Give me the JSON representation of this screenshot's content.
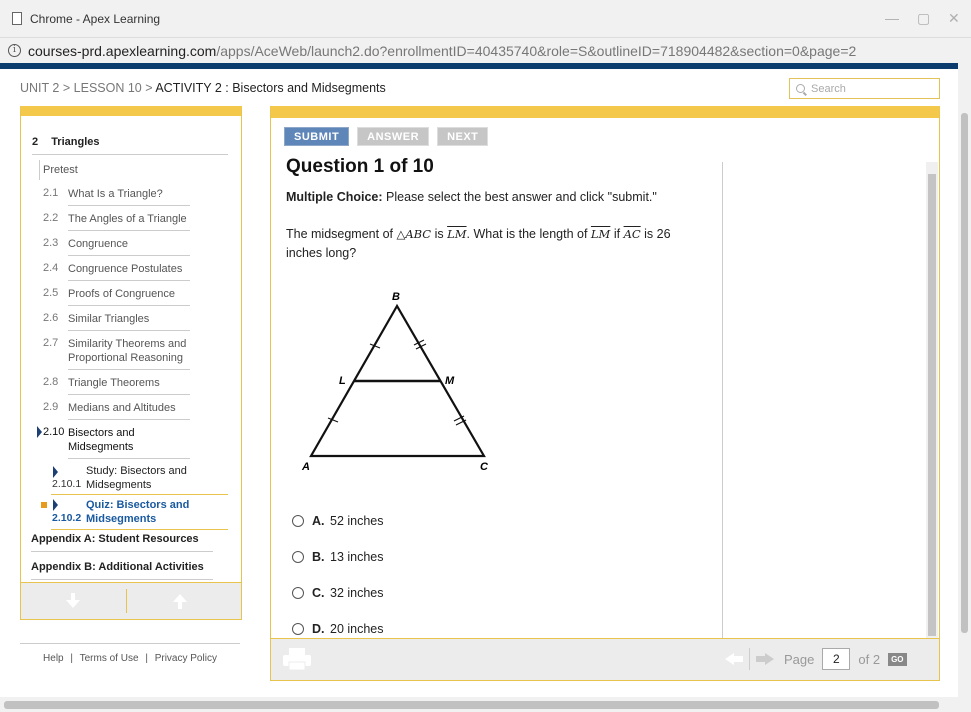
{
  "window": {
    "title": "Chrome - Apex Learning"
  },
  "address": {
    "host": "courses-prd.apexlearning.com",
    "path": "/apps/AceWeb/launch2.do?enrollmentID=40435740&role=S&outlineID=718904482&section=0&page=2"
  },
  "breadcrumb": {
    "unit": "UNIT 2",
    "lesson": "LESSON 10",
    "activity": "ACTIVITY 2 : Bisectors and Midsegments",
    "sep": ">"
  },
  "search": {
    "placeholder": "Search"
  },
  "nav": {
    "unit_num": "2",
    "unit_title": "Triangles",
    "pretest": "Pretest",
    "lessons": [
      {
        "num": "2.1",
        "label": "What Is a Triangle?"
      },
      {
        "num": "2.2",
        "label": "The Angles of a Triangle"
      },
      {
        "num": "2.3",
        "label": "Congruence"
      },
      {
        "num": "2.4",
        "label": "Congruence Postulates"
      },
      {
        "num": "2.5",
        "label": "Proofs of Congruence"
      },
      {
        "num": "2.6",
        "label": "Similar Triangles"
      },
      {
        "num": "2.7",
        "label": "Similarity Theorems and Proportional Reasoning"
      },
      {
        "num": "2.8",
        "label": "Triangle Theorems"
      },
      {
        "num": "2.9",
        "label": "Medians and Altitudes"
      },
      {
        "num": "2.10",
        "label": "Bisectors and Midsegments"
      }
    ],
    "subs": [
      {
        "num": "2.10.1",
        "label": "Study: Bisectors and Midsegments"
      },
      {
        "num": "2.10.2",
        "label": "Quiz: Bisectors and Midsegments"
      }
    ],
    "appendices": [
      "Appendix A: Student Resources",
      "Appendix B: Additional Activities"
    ]
  },
  "footer": {
    "help": "Help",
    "terms": "Terms of Use",
    "privacy": "Privacy Policy",
    "sep": "|"
  },
  "toolbar": {
    "submit": "SUBMIT",
    "answer": "ANSWER",
    "next": "NEXT"
  },
  "question": {
    "title": "Question 1 of 10",
    "type_label": "Multiple Choice:",
    "instructions": "Please select the best answer and click \"submit.\"",
    "text_1": "The midsegment of",
    "triangle": "△ABC",
    "text_2": "is",
    "seg1": "LM",
    "text_3": ". What is the length of",
    "seg2": "LM",
    "text_4": "if",
    "seg3": "AC",
    "text_5": "is 26 inches long?",
    "figure_labels": {
      "a": "A",
      "b": "B",
      "c": "C",
      "l": "L",
      "m": "M"
    },
    "choices": [
      {
        "letter": "A.",
        "text": "52 inches"
      },
      {
        "letter": "B.",
        "text": "13 inches"
      },
      {
        "letter": "C.",
        "text": "32 inches"
      },
      {
        "letter": "D.",
        "text": "20 inches"
      }
    ]
  },
  "pager": {
    "label": "Page",
    "current": "2",
    "of": "of 2",
    "go": "GO"
  }
}
